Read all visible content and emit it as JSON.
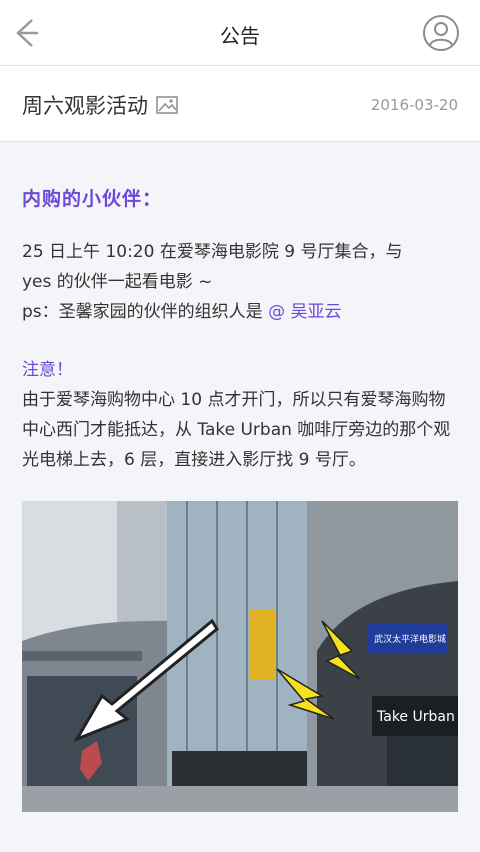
{
  "nav": {
    "title": "公告"
  },
  "article": {
    "title": "周六观影活动",
    "date": "2016-03-20",
    "section_title": "内购的小伙伴：",
    "meet_line1": "25 日上午 10:20 在爱琴海电影院 9 号厅集合，与",
    "meet_line2": "yes 的伙伴一起看电影 ~",
    "organizer_prefix": "ps：圣馨家园的伙伴的组织人是",
    "organizer_mention": "@ 吴亚云",
    "notice_title": "注意！",
    "notice_text": "由于爱琴海购物中心 10 点才开门，所以只有爱琴海购物中心西门才能抵达，从 Take Urban 咖啡厅旁边的那个观光电梯上去，6 层，直接进入影厅找 9 号厅。",
    "photo": {
      "sign_text": "Take Urban",
      "cinema_text": "武汉太平洋电影城"
    }
  },
  "colors": {
    "accent": "#6e48d9",
    "arrow_fill": "#ffffff",
    "lightning": "#f5e11c"
  }
}
